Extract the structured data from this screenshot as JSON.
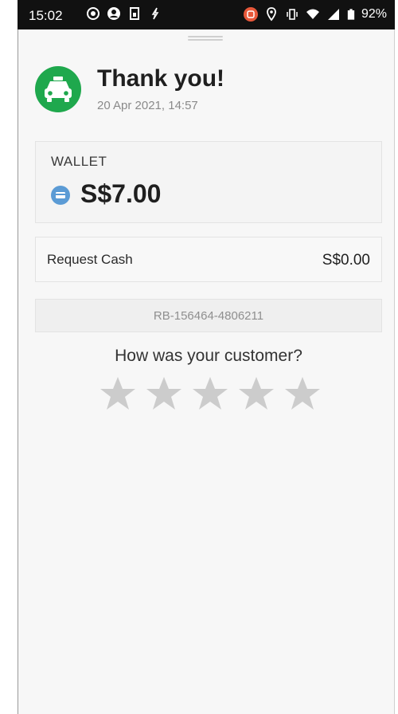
{
  "status_bar": {
    "time": "15:02",
    "battery": "92%"
  },
  "header": {
    "title": "Thank you!",
    "date": "20 Apr 2021, 14:57",
    "icon": "taxi-icon",
    "icon_color": "#1fa84d"
  },
  "wallet": {
    "label": "WALLET",
    "amount": "S$7.00",
    "icon": "wallet-card-icon",
    "icon_color": "#5b9bd5"
  },
  "request_cash": {
    "label": "Request Cash",
    "value": "S$0.00"
  },
  "reference": {
    "id": "RB-156464-4806211"
  },
  "rating": {
    "question": "How was your customer?",
    "stars": 5,
    "selected": 0,
    "star_color": "#cccccc"
  }
}
